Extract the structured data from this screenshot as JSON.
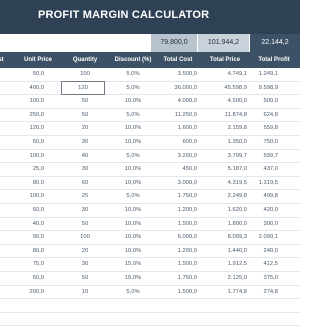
{
  "title": "PROFIT MARGIN CALCULATOR",
  "summary": {
    "total_cost": "79.800,0",
    "total_price": "101.944,2",
    "total_profit": "22.144,2"
  },
  "headers": {
    "unit_cost": "st",
    "unit_price": "Unit Price",
    "quantity": "Quantity",
    "discount": "Discount (%)",
    "total_cost": "Total Cost",
    "total_price": "Total Price",
    "total_profit": "Total Profit"
  },
  "rows": [
    {
      "unit_cost": "",
      "unit_price": "50,0",
      "quantity": "100",
      "discount": "5,0%",
      "total_cost": "3.500,0",
      "total_price": "4.749,1",
      "total_profit": "1.249,1"
    },
    {
      "unit_cost": "",
      "unit_price": "400,0",
      "quantity": "120",
      "discount": "5,0%",
      "total_cost": "36.000,0",
      "total_price": "45.598,9",
      "total_profit": "9.598,9"
    },
    {
      "unit_cost": "",
      "unit_price": "100,0",
      "quantity": "50",
      "discount": "10,0%",
      "total_cost": "4.000,0",
      "total_price": "4.500,0",
      "total_profit": "500,0"
    },
    {
      "unit_cost": "",
      "unit_price": "250,0",
      "quantity": "50",
      "discount": "5,0%",
      "total_cost": "11.250,0",
      "total_price": "11.874,8",
      "total_profit": "624,8"
    },
    {
      "unit_cost": "",
      "unit_price": "120,0",
      "quantity": "20",
      "discount": "10,0%",
      "total_cost": "1.600,0",
      "total_price": "2.159,8",
      "total_profit": "559,8"
    },
    {
      "unit_cost": "",
      "unit_price": "50,0",
      "quantity": "30",
      "discount": "10,0%",
      "total_cost": "600,0",
      "total_price": "1.350,0",
      "total_profit": "750,0"
    },
    {
      "unit_cost": "",
      "unit_price": "100,0",
      "quantity": "40",
      "discount": "5,0%",
      "total_cost": "3.200,0",
      "total_price": "3.799,7",
      "total_profit": "599,7"
    },
    {
      "unit_cost": "",
      "unit_price": "25,0",
      "quantity": "30",
      "discount": "10,0%",
      "total_cost": "450,0",
      "total_price": "5.187,0",
      "total_profit": "437,0"
    },
    {
      "unit_cost": "",
      "unit_price": "80,0",
      "quantity": "60",
      "discount": "10,0%",
      "total_cost": "3.000,0",
      "total_price": "4.319,5",
      "total_profit": "1.319,5"
    },
    {
      "unit_cost": "",
      "unit_price": "100,0",
      "quantity": "25",
      "discount": "5,0%",
      "total_cost": "1.750,0",
      "total_price": "2.249,8",
      "total_profit": "499,8"
    },
    {
      "unit_cost": "",
      "unit_price": "60,0",
      "quantity": "30",
      "discount": "10,0%",
      "total_cost": "1.200,0",
      "total_price": "1.620,0",
      "total_profit": "420,0"
    },
    {
      "unit_cost": "",
      "unit_price": "40,0",
      "quantity": "50",
      "discount": "10,0%",
      "total_cost": "1.500,0",
      "total_price": "1.800,0",
      "total_profit": "300,0"
    },
    {
      "unit_cost": "",
      "unit_price": "90,0",
      "quantity": "100",
      "discount": "10,0%",
      "total_cost": "6.000,0",
      "total_price": "8.099,3",
      "total_profit": "2.099,1"
    },
    {
      "unit_cost": "",
      "unit_price": "80,0",
      "quantity": "20",
      "discount": "10,0%",
      "total_cost": "1.200,0",
      "total_price": "1.440,0",
      "total_profit": "240,0"
    },
    {
      "unit_cost": "",
      "unit_price": "75,0",
      "quantity": "30",
      "discount": "15,0%",
      "total_cost": "1.500,0",
      "total_price": "1.912,5",
      "total_profit": "412,5"
    },
    {
      "unit_cost": "",
      "unit_price": "50,0",
      "quantity": "50",
      "discount": "15,0%",
      "total_cost": "1.750,0",
      "total_price": "2.125,0",
      "total_profit": "375,0"
    },
    {
      "unit_cost": "",
      "unit_price": "200,0",
      "quantity": "10",
      "discount": "5,0%",
      "total_cost": "1.500,0",
      "total_price": "1.774,8",
      "total_profit": "274,8"
    }
  ],
  "blank_rows": 2,
  "colors": {
    "title_bg": "#2f4154",
    "header_bg": "#3d5166",
    "summary_bg_cost": "#b9c3cd",
    "summary_bg_price": "#c9d1da",
    "summary_bg_profit": "#3d5166"
  }
}
